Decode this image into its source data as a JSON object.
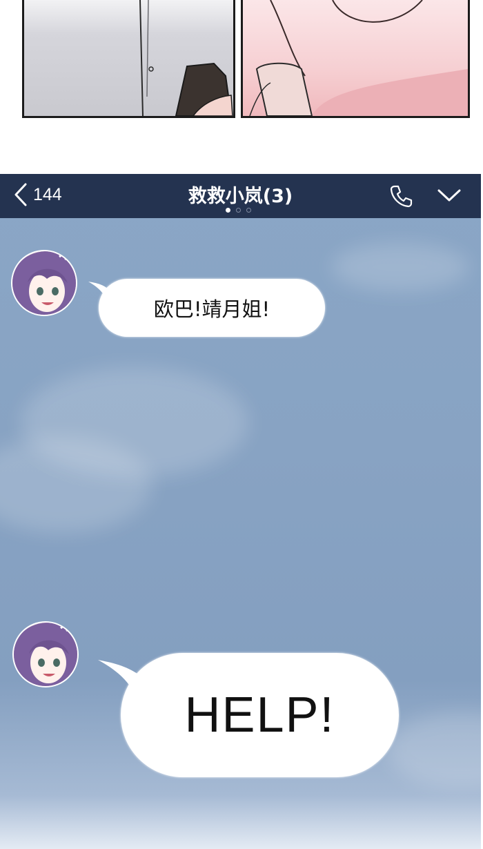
{
  "chat": {
    "back_count": "144",
    "title": "救救小岚(3)",
    "page_indicator": {
      "current": 1,
      "total": 3
    },
    "icons": {
      "back": "chevron-left-icon",
      "call": "phone-icon",
      "expand": "chevron-down-icon"
    },
    "messages": [
      {
        "sender_avatar": "purple-hair-girl-avatar",
        "text": "欧巴!靖月姐!"
      },
      {
        "sender_avatar": "purple-hair-girl-avatar",
        "text": "HELP!"
      }
    ]
  },
  "colors": {
    "topbar": "#243350",
    "chat_background": "#88a3c3",
    "bubble": "#ffffff",
    "avatar_hair": "#7b5f9e"
  }
}
